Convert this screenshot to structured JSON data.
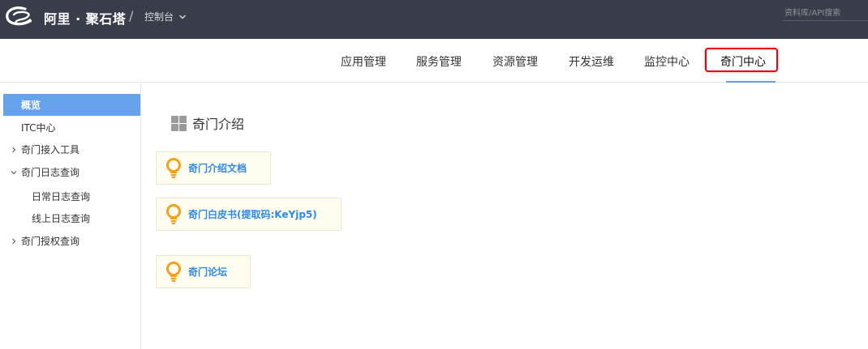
{
  "header": {
    "brand": "阿里 · 聚石塔",
    "separator": "/",
    "console_label": "控制台",
    "search_placeholder": "资料库/API搜索"
  },
  "nav": {
    "items": [
      "应用管理",
      "服务管理",
      "资源管理",
      "开发运维",
      "监控中心"
    ],
    "active": "奇门中心"
  },
  "sidebar": {
    "items": [
      {
        "label": "概览"
      },
      {
        "label": "ITC中心"
      },
      {
        "label": "奇门接入工具"
      },
      {
        "label": "奇门日志查询"
      },
      {
        "label": "日常日志查询"
      },
      {
        "label": "线上日志查询"
      },
      {
        "label": "奇门授权查询"
      }
    ]
  },
  "content": {
    "title": "奇门介绍",
    "cards": [
      {
        "label": "奇门介绍文档"
      },
      {
        "label": "奇门白皮书(提取码:KeYjp5)"
      },
      {
        "label": "奇门论坛"
      }
    ]
  },
  "colors": {
    "topbar": "#393d49",
    "accent": "#66a3eb",
    "highlight_border": "#e60012",
    "link": "#2e8ae6",
    "bulb": "#f0a21c"
  },
  "icons": {
    "logo": "alibaba-logo-icon",
    "console_chevron": "chevron-down-icon",
    "title_icon": "grid-icon",
    "card_icon": "lightbulb-icon",
    "caret_collapsed": "chevron-right-icon",
    "caret_expanded": "chevron-down-icon"
  }
}
